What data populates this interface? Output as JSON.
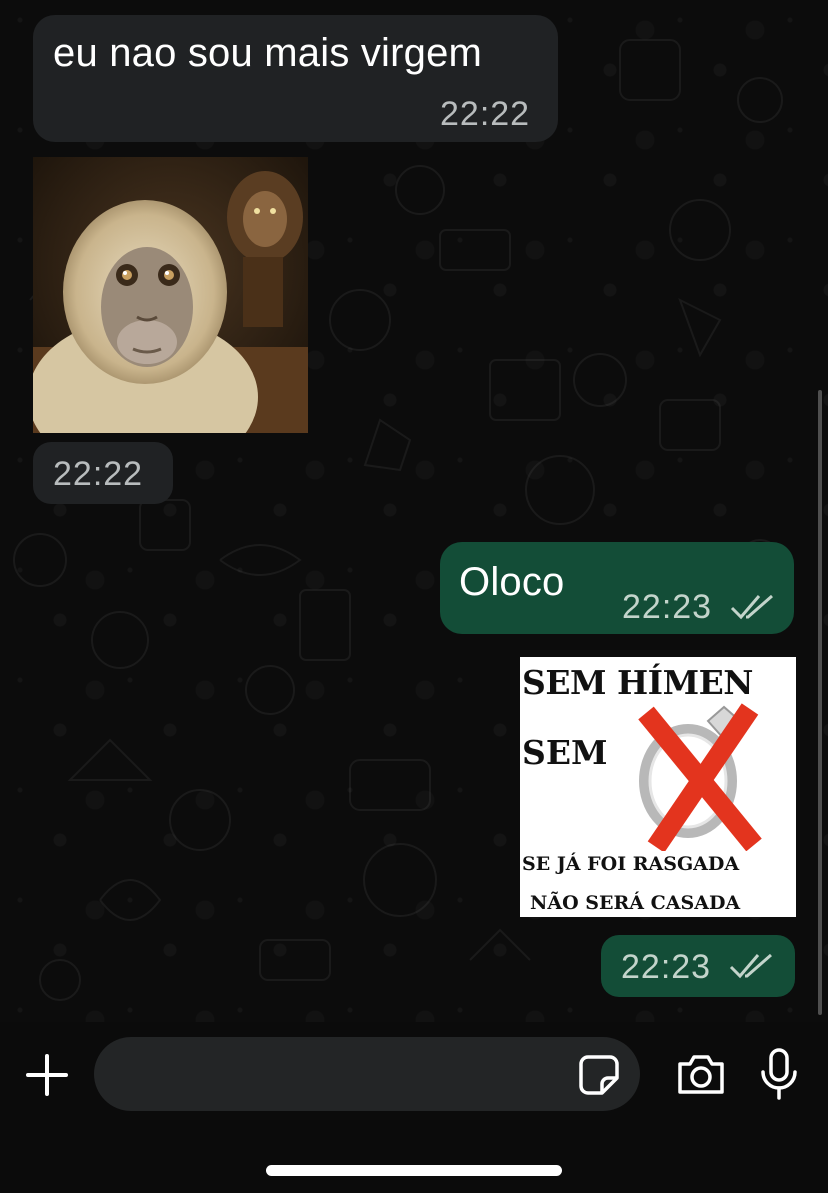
{
  "messages": [
    {
      "id": "m1",
      "direction": "incoming",
      "type": "text",
      "text": "eu nao sou mais virgem",
      "time": "22:22"
    },
    {
      "id": "m2",
      "direction": "incoming",
      "type": "image",
      "image": "monkey-selfie-with-lion",
      "time": "22:22"
    },
    {
      "id": "m3",
      "direction": "outgoing",
      "type": "text",
      "text": "Oloco",
      "time": "22:23",
      "status": "read-double-check"
    },
    {
      "id": "m4",
      "direction": "outgoing",
      "type": "image",
      "image": "meme-ring-crossed",
      "meme_text": {
        "line1": "SEM HÍMEN",
        "line2": "SEM",
        "line3": "SE JÁ FOI RASGADA",
        "line4": "NÃO SERÁ CASADA"
      },
      "time": "22:23",
      "status": "read-double-check"
    }
  ],
  "composer": {
    "placeholder": "",
    "icons": [
      "plus-icon",
      "sticker-icon",
      "camera-icon",
      "microphone-icon"
    ]
  },
  "colors": {
    "incoming_bubble": "#202224",
    "outgoing_bubble": "#134d37",
    "background": "#0c0c0c"
  }
}
